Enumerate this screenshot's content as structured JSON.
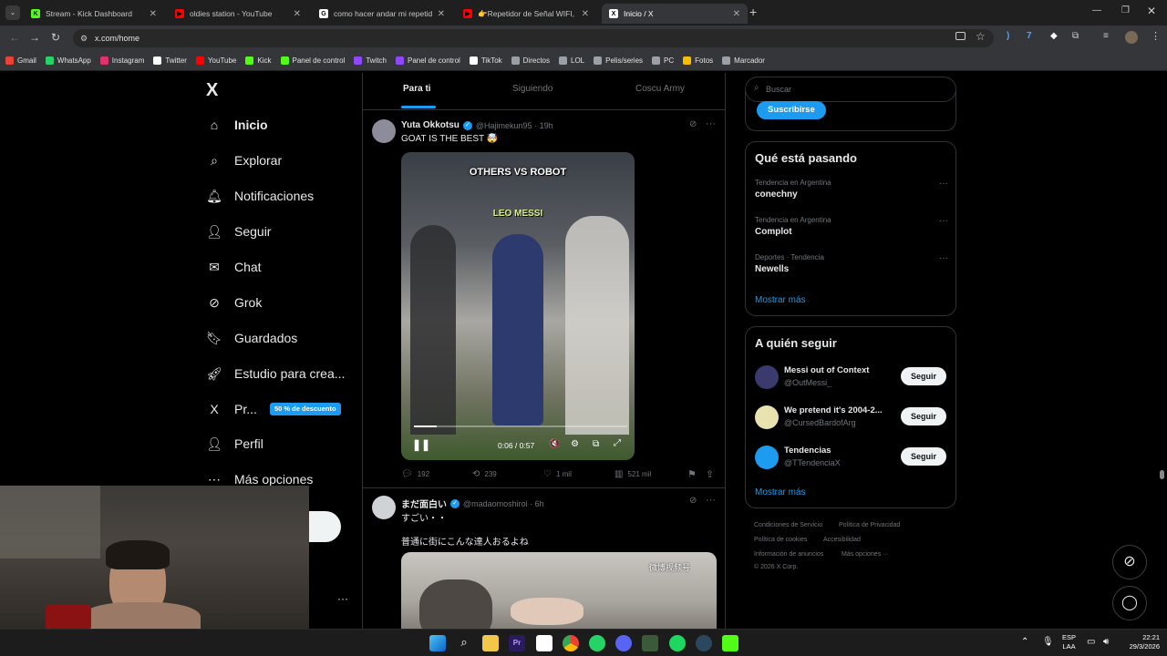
{
  "browser": {
    "tabs": [
      {
        "title": "Stream - Kick Dashboard",
        "color": "#53fc18",
        "glyph": "K"
      },
      {
        "title": "oldies station - YouTube",
        "color": "#ff0000",
        "glyph": "▶"
      },
      {
        "title": "como hacer andar mi repetidor",
        "color": "#ffffff",
        "glyph": "G"
      },
      {
        "title": "👉Repetidor de Señal WIFI, Co",
        "color": "#ff0000",
        "glyph": "▶"
      },
      {
        "title": "Inicio / X",
        "color": "#ffffff",
        "glyph": "X"
      }
    ],
    "url": "x.com/home",
    "bookmarks": [
      {
        "label": "Gmail",
        "color": "#ea4335"
      },
      {
        "label": "WhatsApp",
        "color": "#25d366"
      },
      {
        "label": "Instagram",
        "color": "#e1306c"
      },
      {
        "label": "Twitter",
        "color": "#ffffff"
      },
      {
        "label": "YouTube",
        "color": "#ff0000"
      },
      {
        "label": "Kick",
        "color": "#53fc18"
      },
      {
        "label": "Panel de control",
        "color": "#53fc18"
      },
      {
        "label": "Twitch",
        "color": "#9146ff"
      },
      {
        "label": "Panel de control",
        "color": "#9146ff"
      },
      {
        "label": "TikTok",
        "color": "#ffffff"
      },
      {
        "label": "Directos",
        "color": "#9aa0a6"
      },
      {
        "label": "LOL",
        "color": "#9aa0a6"
      },
      {
        "label": "Pelis/series",
        "color": "#9aa0a6"
      },
      {
        "label": "PC",
        "color": "#9aa0a6"
      },
      {
        "label": "Fotos",
        "color": "#fbbc04"
      },
      {
        "label": "Marcador",
        "color": "#9aa0a6"
      }
    ]
  },
  "nav": {
    "logo": "X",
    "items": [
      "Inicio",
      "Explorar",
      "Notificaciones",
      "Seguir",
      "Chat",
      "Grok",
      "Guardados",
      "Estudio para crea...",
      "Pr...",
      "Perfil",
      "Más opciones"
    ],
    "premium_badge": "50 % de descuento"
  },
  "timeline": {
    "tabs": [
      "Para ti",
      "Siguiendo",
      "Coscu Army"
    ],
    "tweet1": {
      "name": "Yuta Okkotsu",
      "handle": "@Hajimekun95 · 19h",
      "text": "GOAT IS THE BEST 🤯",
      "video_overlay_1": "OTHERS VS ROBOT",
      "video_overlay_2": "LEO MESSI",
      "video_time": "0:06 / 0:57",
      "replies": "192",
      "reposts": "239",
      "likes": "1 mil",
      "views": "521 mil"
    },
    "tweet2": {
      "name": "まだ面白い",
      "handle": "@madaomoshiroi · 6h",
      "text1": "すごい・・",
      "text2": "普通に街にこんな達人おるよね",
      "watermark": "微博视频号"
    }
  },
  "sidebar": {
    "search_placeholder": "Buscar",
    "subscribe_label": "Suscribirse",
    "trends_title": "Qué está pasando",
    "trends": [
      {
        "context": "Tendencia en Argentina",
        "name": "conechny"
      },
      {
        "context": "Tendencia en Argentina",
        "name": "Complot"
      },
      {
        "context": "Deportes · Tendencia",
        "name": "Newells"
      }
    ],
    "show_more": "Mostrar más",
    "follow_title": "A quién seguir",
    "follow": [
      {
        "name": "Messi out of Context",
        "handle": "@OutMessi_",
        "button": "Seguir"
      },
      {
        "name": "We pretend it's 2004-2...",
        "handle": "@CursedBardofArg",
        "button": "Seguir"
      },
      {
        "name": "Tendencias",
        "handle": "@TTendenciaX",
        "button": "Seguir"
      }
    ],
    "footer": [
      "Condiciones de Servicio",
      "Política de Privacidad",
      "Política de cookies",
      "Accesibilidad",
      "Información de anuncios",
      "Más opciones ···",
      "© 2026 X Corp."
    ]
  },
  "taskbar": {
    "lang1": "ESP",
    "lang2": "LAA",
    "time": "22:21",
    "date": "29/3/2026"
  }
}
